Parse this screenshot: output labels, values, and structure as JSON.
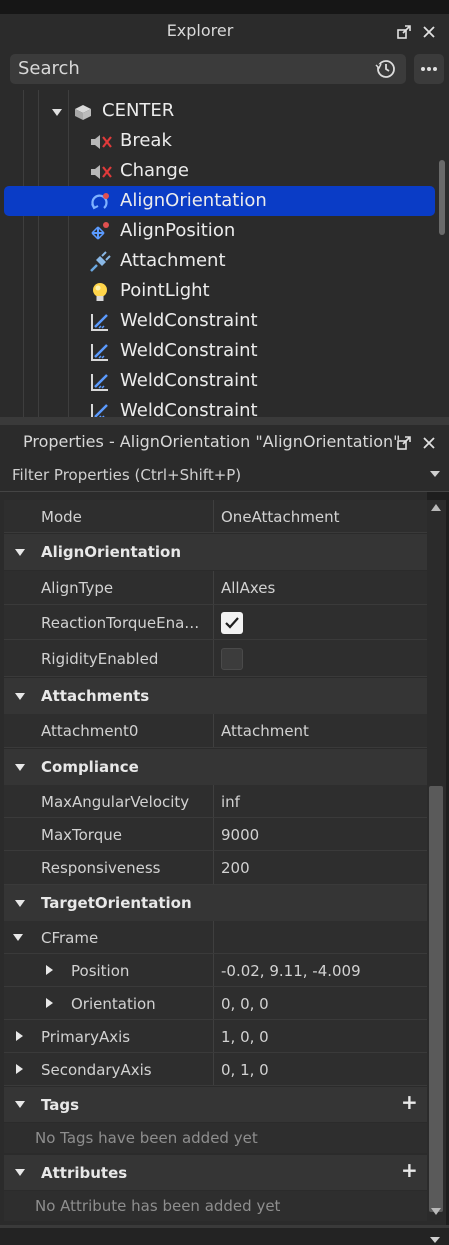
{
  "colors": {
    "selection": "#0a3cc6",
    "panel_bg": "#2b2b2b",
    "text": "#e6e6e6"
  },
  "explorer": {
    "title": "Explorer",
    "search_placeholder": "Search",
    "tree": [
      {
        "label": "CENTER",
        "icon": "model-icon",
        "level": 0,
        "expanded": true,
        "selected": false
      },
      {
        "label": "Break",
        "icon": "sound-icon",
        "level": 1,
        "selected": false
      },
      {
        "label": "Change",
        "icon": "sound-icon",
        "level": 1,
        "selected": false
      },
      {
        "label": "AlignOrientation",
        "icon": "align-orientation-icon",
        "level": 1,
        "selected": true
      },
      {
        "label": "AlignPosition",
        "icon": "align-position-icon",
        "level": 1,
        "selected": false
      },
      {
        "label": "Attachment",
        "icon": "attachment-icon",
        "level": 1,
        "selected": false
      },
      {
        "label": "PointLight",
        "icon": "light-bulb-icon",
        "level": 1,
        "selected": false
      },
      {
        "label": "WeldConstraint",
        "icon": "weld-constraint-icon",
        "level": 1,
        "selected": false
      },
      {
        "label": "WeldConstraint",
        "icon": "weld-constraint-icon",
        "level": 1,
        "selected": false
      },
      {
        "label": "WeldConstraint",
        "icon": "weld-constraint-icon",
        "level": 1,
        "selected": false
      },
      {
        "label": "WeldConstraint",
        "icon": "weld-constraint-icon",
        "level": 1,
        "selected": false
      }
    ]
  },
  "properties": {
    "title": "Properties - AlignOrientation \"AlignOrientation\"",
    "filter_placeholder": "Filter Properties (Ctrl+Shift+P)",
    "rows": [
      {
        "kind": "prop",
        "name": "Mode",
        "value": "OneAttachment"
      },
      {
        "kind": "section",
        "name": "AlignOrientation"
      },
      {
        "kind": "prop",
        "name": "AlignType",
        "value": "AllAxes"
      },
      {
        "kind": "bool",
        "name": "ReactionTorqueEna…",
        "checked": true
      },
      {
        "kind": "bool",
        "name": "RigidityEnabled",
        "checked": false
      },
      {
        "kind": "section",
        "name": "Attachments"
      },
      {
        "kind": "prop",
        "name": "Attachment0",
        "value": "Attachment"
      },
      {
        "kind": "section",
        "name": "Compliance"
      },
      {
        "kind": "prop",
        "name": "MaxAngularVelocity",
        "value": "inf"
      },
      {
        "kind": "prop",
        "name": "MaxTorque",
        "value": "9000"
      },
      {
        "kind": "prop",
        "name": "Responsiveness",
        "value": "200"
      },
      {
        "kind": "section",
        "name": "TargetOrientation"
      },
      {
        "kind": "group",
        "name": "CFrame",
        "value": "",
        "expanded": true
      },
      {
        "kind": "subprop",
        "name": "Position",
        "value": "-0.02, 9.11, -4.009"
      },
      {
        "kind": "subprop",
        "name": "Orientation",
        "value": "0, 0, 0"
      },
      {
        "kind": "collapsed",
        "name": "PrimaryAxis",
        "value": "1, 0, 0"
      },
      {
        "kind": "collapsed",
        "name": "SecondaryAxis",
        "value": "0, 1, 0"
      },
      {
        "kind": "section",
        "name": "Tags",
        "plus": true
      },
      {
        "kind": "empty",
        "name": "No Tags have been added yet"
      },
      {
        "kind": "section",
        "name": "Attributes",
        "plus": true
      },
      {
        "kind": "empty",
        "name": "No Attribute has been added yet"
      }
    ]
  }
}
